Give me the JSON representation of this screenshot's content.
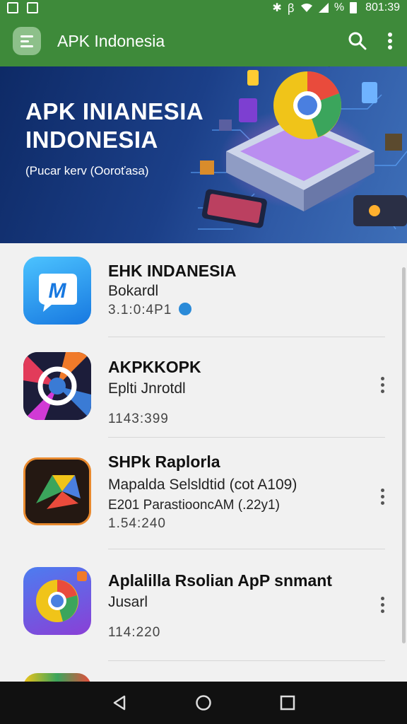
{
  "status_bar": {
    "time": "801:39",
    "battery_text": "%"
  },
  "app_bar": {
    "title": "APK Indonesia"
  },
  "banner": {
    "heading_line1": "APK INIANESIA",
    "heading_line2": "INDONESIA",
    "subtitle": "(Pucar kerv (Ooroťasa)"
  },
  "apps": [
    {
      "title": "EHK INDANESIA",
      "line1": "Bokardl",
      "meta": "3.1:0:4P1"
    },
    {
      "title": "AKPKKOPK",
      "line1": "Eplti Jnrotdl",
      "meta": "1143:399"
    },
    {
      "title": "SHPk Raplorla",
      "line1": "Mapalda Selsldtid (cot A109)",
      "line2": "E201 ParastiooncAM (.22y1)",
      "meta": "1.54:240"
    },
    {
      "title": "Aplalilla Rsolian ApP snmant",
      "line1": "Jusarl",
      "meta": "114:220"
    }
  ],
  "colors": {
    "primary": "#3e8a3a",
    "banner": "#1b3f88",
    "list_bg": "#f1f1f1",
    "verified": "#2a8ad8"
  }
}
